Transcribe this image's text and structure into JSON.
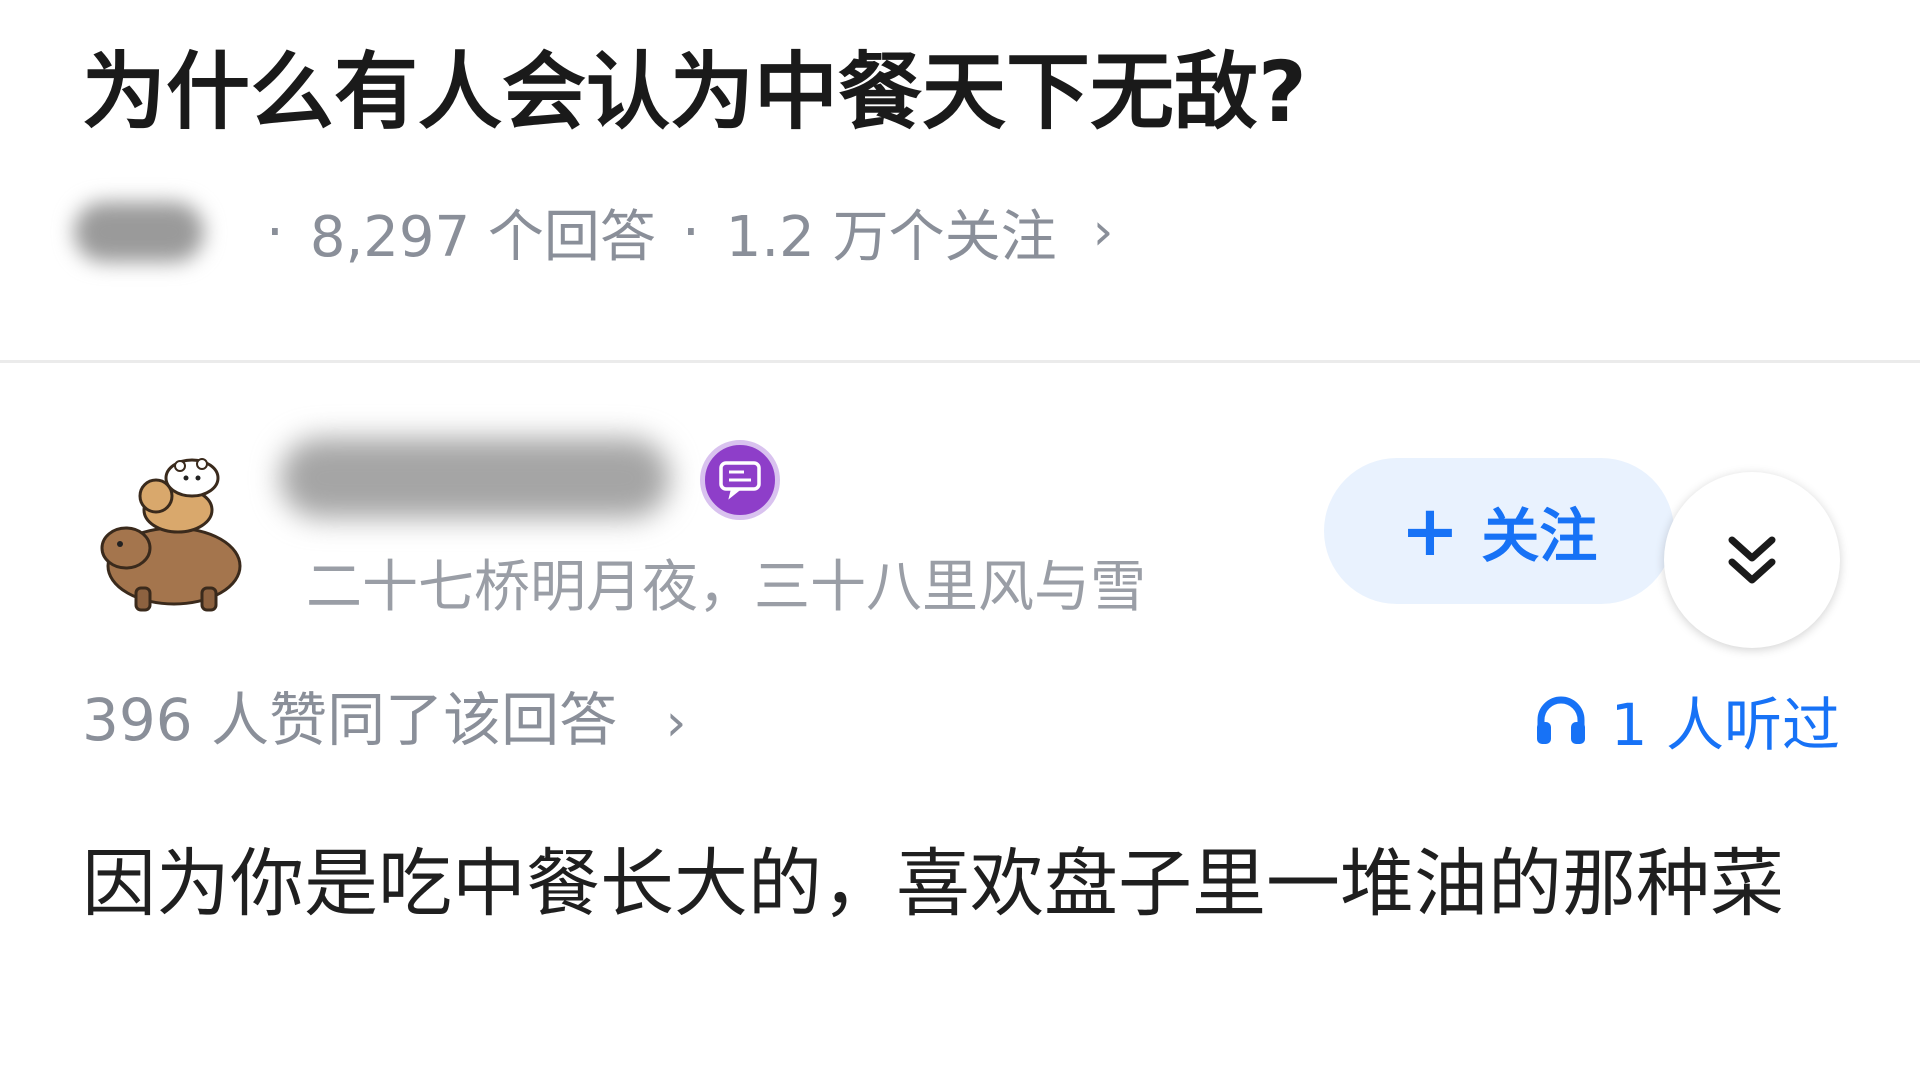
{
  "question": {
    "title": "为什么有人会认为中餐天下无敌?",
    "separator": "·",
    "answer_count": "8,297 个回答",
    "follower_count": "1.2 万个关注",
    "chevron": "›"
  },
  "answer": {
    "author_bio": "二十七桥明月夜，三十八里风与雪",
    "follow_label": "关注",
    "follow_plus": "+",
    "votes_text": "396 人赞同了该回答",
    "votes_chevron": "›",
    "listen_text": "1 人听过",
    "content": "因为你是吃中餐长大的，喜欢盘子里一堆油的那种菜"
  },
  "icons": {
    "badge": "chat-bubble-icon",
    "expand": "double-chevron-down-icon",
    "listen": "headphones-icon"
  },
  "colors": {
    "accent": "#1772f6",
    "follow_bg": "#e9f2fe",
    "badge": "#8e3ec9",
    "meta_text": "#8a8f99"
  }
}
